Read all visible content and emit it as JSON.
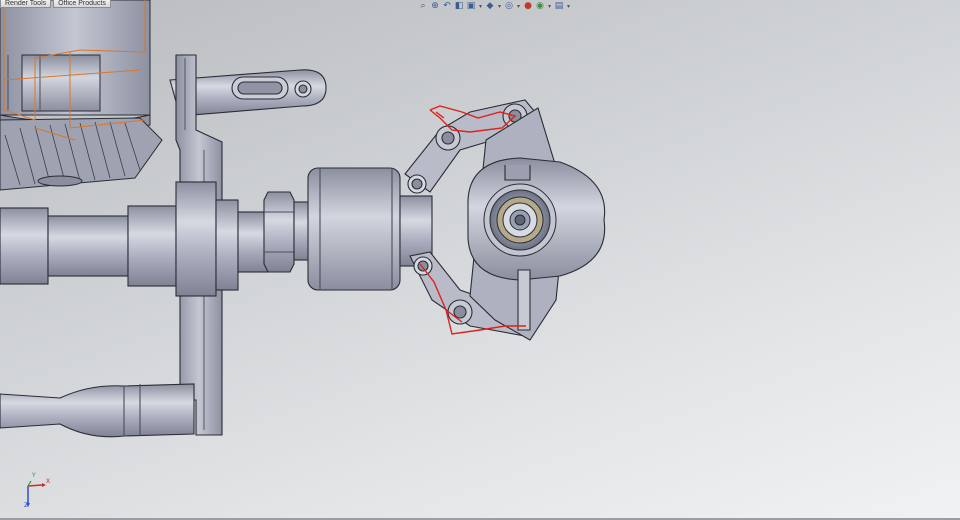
{
  "window": {
    "tabs": [
      {
        "label": "Render Tools"
      },
      {
        "label": "Office Products"
      }
    ]
  },
  "heads_up_toolbar": {
    "buttons": [
      {
        "icon": "zoom-to-fit-icon"
      },
      {
        "icon": "zoom-to-area-icon"
      },
      {
        "icon": "previous-view-icon"
      },
      {
        "icon": "section-view-icon"
      },
      {
        "icon": "view-orientation-icon",
        "has_dropdown": true
      },
      {
        "icon": "display-style-icon",
        "has_dropdown": true
      },
      {
        "icon": "hide-show-items-icon",
        "has_dropdown": true
      },
      {
        "icon": "edit-appearance-icon"
      },
      {
        "icon": "apply-scene-icon",
        "has_dropdown": true
      },
      {
        "icon": "view-settings-icon",
        "has_dropdown": true
      }
    ]
  },
  "triad": {
    "x_label": "X",
    "y_label": "Y",
    "z_label": "Z",
    "x_color": "#d12b2b",
    "y_color": "#2b9a2b",
    "z_color": "#2b4fd1"
  },
  "colors": {
    "part_fill": "#a5a9b8",
    "part_edge": "#2a2d35",
    "sketch": "#e0201b",
    "selection_box": "#d8772e"
  }
}
